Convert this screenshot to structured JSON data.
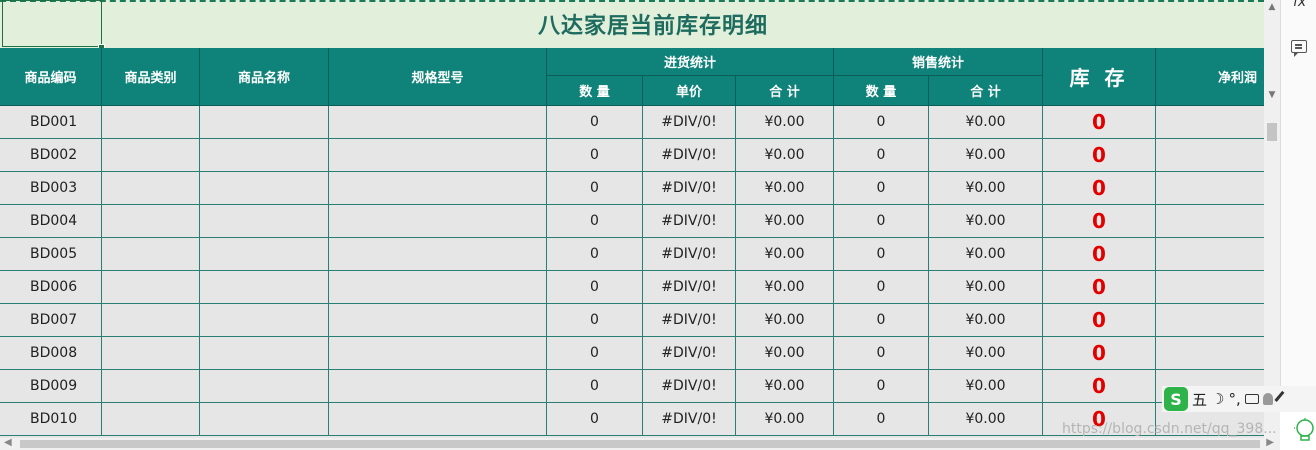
{
  "title": "八达家居当前库存明细",
  "headers": {
    "code": "商品编码",
    "category": "商品类别",
    "name": "商品名称",
    "spec": "规格型号",
    "purchase_group": "进货统计",
    "sales_group": "销售统计",
    "stock": "库 存",
    "profit": "净利润",
    "p_qty": "数 量",
    "p_price": "单价",
    "p_total": "合 计",
    "s_qty": "数 量",
    "s_total": "合 计"
  },
  "rows": [
    {
      "code": "BD001",
      "p_qty": "0",
      "p_price": "#DIV/0!",
      "p_total": "¥0.00",
      "s_qty": "0",
      "s_total": "¥0.00",
      "stock": "0"
    },
    {
      "code": "BD002",
      "p_qty": "0",
      "p_price": "#DIV/0!",
      "p_total": "¥0.00",
      "s_qty": "0",
      "s_total": "¥0.00",
      "stock": "0"
    },
    {
      "code": "BD003",
      "p_qty": "0",
      "p_price": "#DIV/0!",
      "p_total": "¥0.00",
      "s_qty": "0",
      "s_total": "¥0.00",
      "stock": "0"
    },
    {
      "code": "BD004",
      "p_qty": "0",
      "p_price": "#DIV/0!",
      "p_total": "¥0.00",
      "s_qty": "0",
      "s_total": "¥0.00",
      "stock": "0"
    },
    {
      "code": "BD005",
      "p_qty": "0",
      "p_price": "#DIV/0!",
      "p_total": "¥0.00",
      "s_qty": "0",
      "s_total": "¥0.00",
      "stock": "0"
    },
    {
      "code": "BD006",
      "p_qty": "0",
      "p_price": "#DIV/0!",
      "p_total": "¥0.00",
      "s_qty": "0",
      "s_total": "¥0.00",
      "stock": "0"
    },
    {
      "code": "BD007",
      "p_qty": "0",
      "p_price": "#DIV/0!",
      "p_total": "¥0.00",
      "s_qty": "0",
      "s_total": "¥0.00",
      "stock": "0"
    },
    {
      "code": "BD008",
      "p_qty": "0",
      "p_price": "#DIV/0!",
      "p_total": "¥0.00",
      "s_qty": "0",
      "s_total": "¥0.00",
      "stock": "0"
    },
    {
      "code": "BD009",
      "p_qty": "0",
      "p_price": "#DIV/0!",
      "p_total": "¥0.00",
      "s_qty": "0",
      "s_total": "¥0.00",
      "stock": "0"
    },
    {
      "code": "BD010",
      "p_qty": "0",
      "p_price": "#DIV/0!",
      "p_total": "¥0.00",
      "s_qty": "0",
      "s_total": "¥0.00",
      "stock": "0"
    }
  ],
  "side_panel": {
    "fx_label": "fx"
  },
  "ime": {
    "logo": "S",
    "mode": "五",
    "moon": "☽",
    "punct": "°,"
  },
  "watermark": "https://blog.csdn.net/qq_398..."
}
